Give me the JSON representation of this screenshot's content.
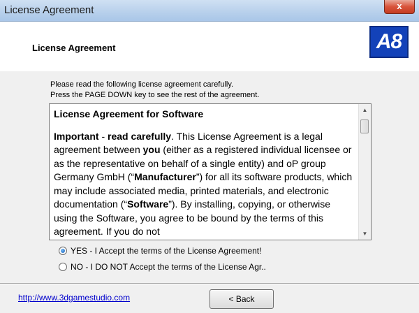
{
  "window": {
    "title": "License Agreement",
    "close_glyph": "x"
  },
  "header": {
    "title": "License Agreement",
    "logo_text": "A8"
  },
  "instructions": {
    "line1": "Please read the following license agreement carefully.",
    "line2": "Press the PAGE DOWN key to see the rest of the agreement."
  },
  "license": {
    "heading": "License Agreement for Software",
    "p1_lead": "Important",
    "p1_dash": " - ",
    "p1_bold": "read carefully",
    "p1_a": ". This License Agreement is a legal agreement between ",
    "p1_you": "you",
    "p1_b": " (either as a registered individual licensee or as the representative on behalf of a single entity) and oP group Germany GmbH (“",
    "p1_manufacturer": "Manufacturer",
    "p1_c": "”) for all its software products, which may include associated media, printed materials, and electronic documentation (“",
    "p1_software": "Software",
    "p1_d": "”). By installing, copying, or otherwise using the Software, you agree to be bound by the terms of this agreement. If you do not"
  },
  "scrollbar": {
    "up_glyph": "▲",
    "down_glyph": "▼"
  },
  "options": {
    "accept_label": "YES - I Accept the terms of the License Agreement!",
    "decline_label": "NO - I DO NOT Accept the terms of the License Agr..",
    "selected": "accept"
  },
  "footer": {
    "url": "http://www.3dgamestudio.com",
    "back_label": "< Back"
  },
  "colors": {
    "logo_blue": "#1342b9",
    "link_blue": "#0000cc"
  }
}
